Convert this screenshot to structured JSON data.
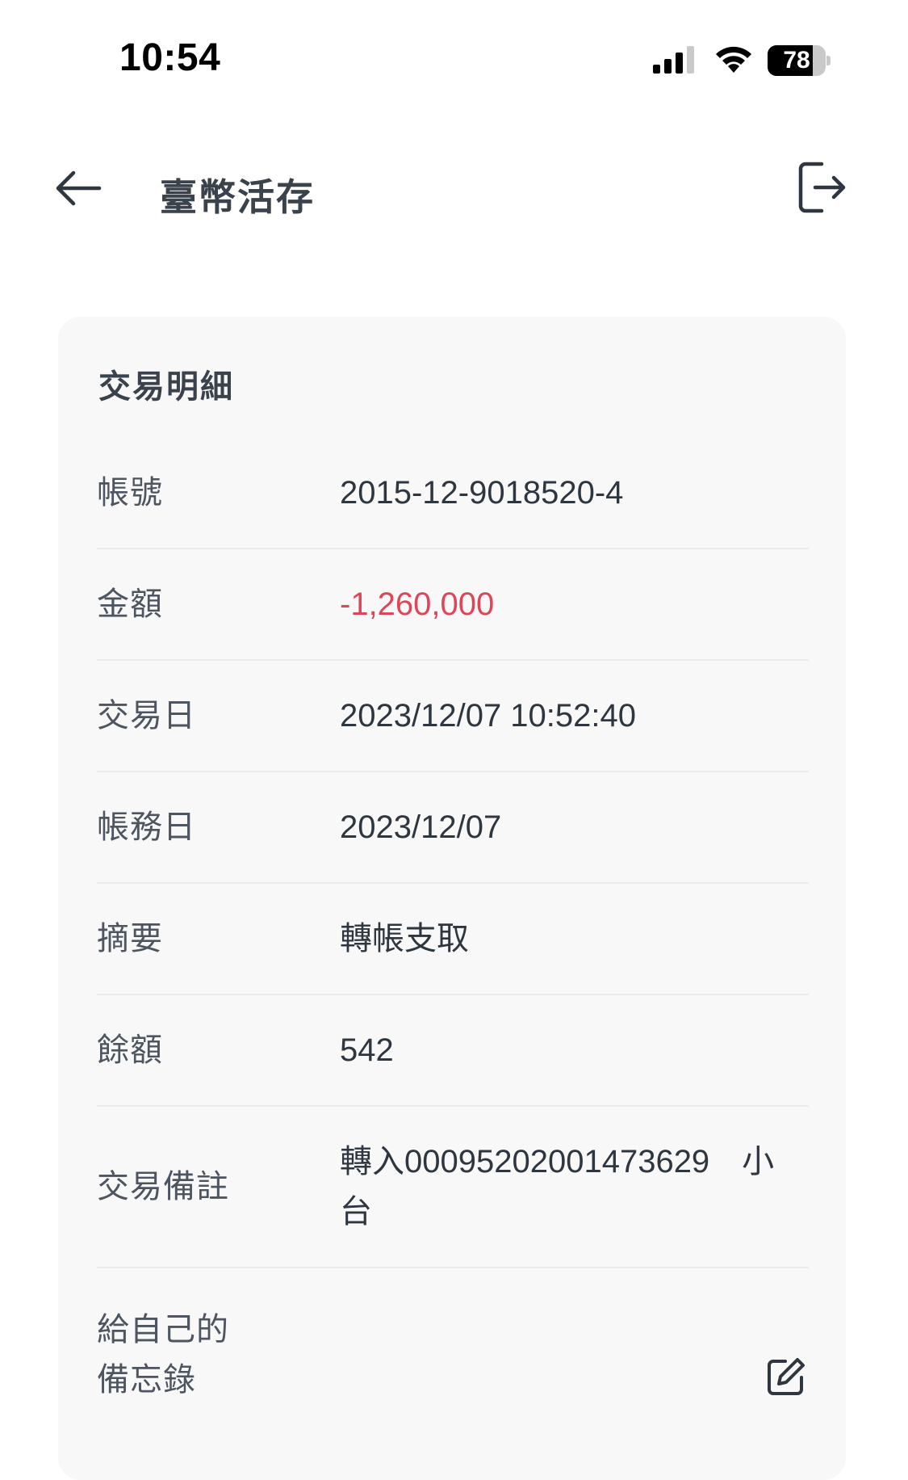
{
  "status_bar": {
    "time": "10:54",
    "battery_level": "78",
    "icons": [
      "cellular-signal-icon",
      "wifi-icon",
      "battery-icon"
    ]
  },
  "header": {
    "title": "臺幣活存",
    "back_icon": "arrow-left-icon",
    "logout_icon": "logout-icon"
  },
  "card": {
    "title": "交易明細",
    "rows": [
      {
        "label": "帳號",
        "value": "2015-12-9018520-4"
      },
      {
        "label": "金額",
        "value": "-1,260,000"
      },
      {
        "label": "交易日",
        "value": "2023/12/07 10:52:40"
      },
      {
        "label": "帳務日",
        "value": "2023/12/07"
      },
      {
        "label": "摘要",
        "value": "轉帳支取"
      },
      {
        "label": "餘額",
        "value": "542"
      },
      {
        "label": "交易備註",
        "value": "轉入00095202001473629　小台"
      },
      {
        "label": "給自己的備忘錄",
        "value": ""
      }
    ],
    "edit_icon": "edit-icon"
  },
  "colors": {
    "negative_amount": "#e04457",
    "text": "#2e3640",
    "card_background": "#f8f8f9",
    "divider": "#e9ebed"
  }
}
